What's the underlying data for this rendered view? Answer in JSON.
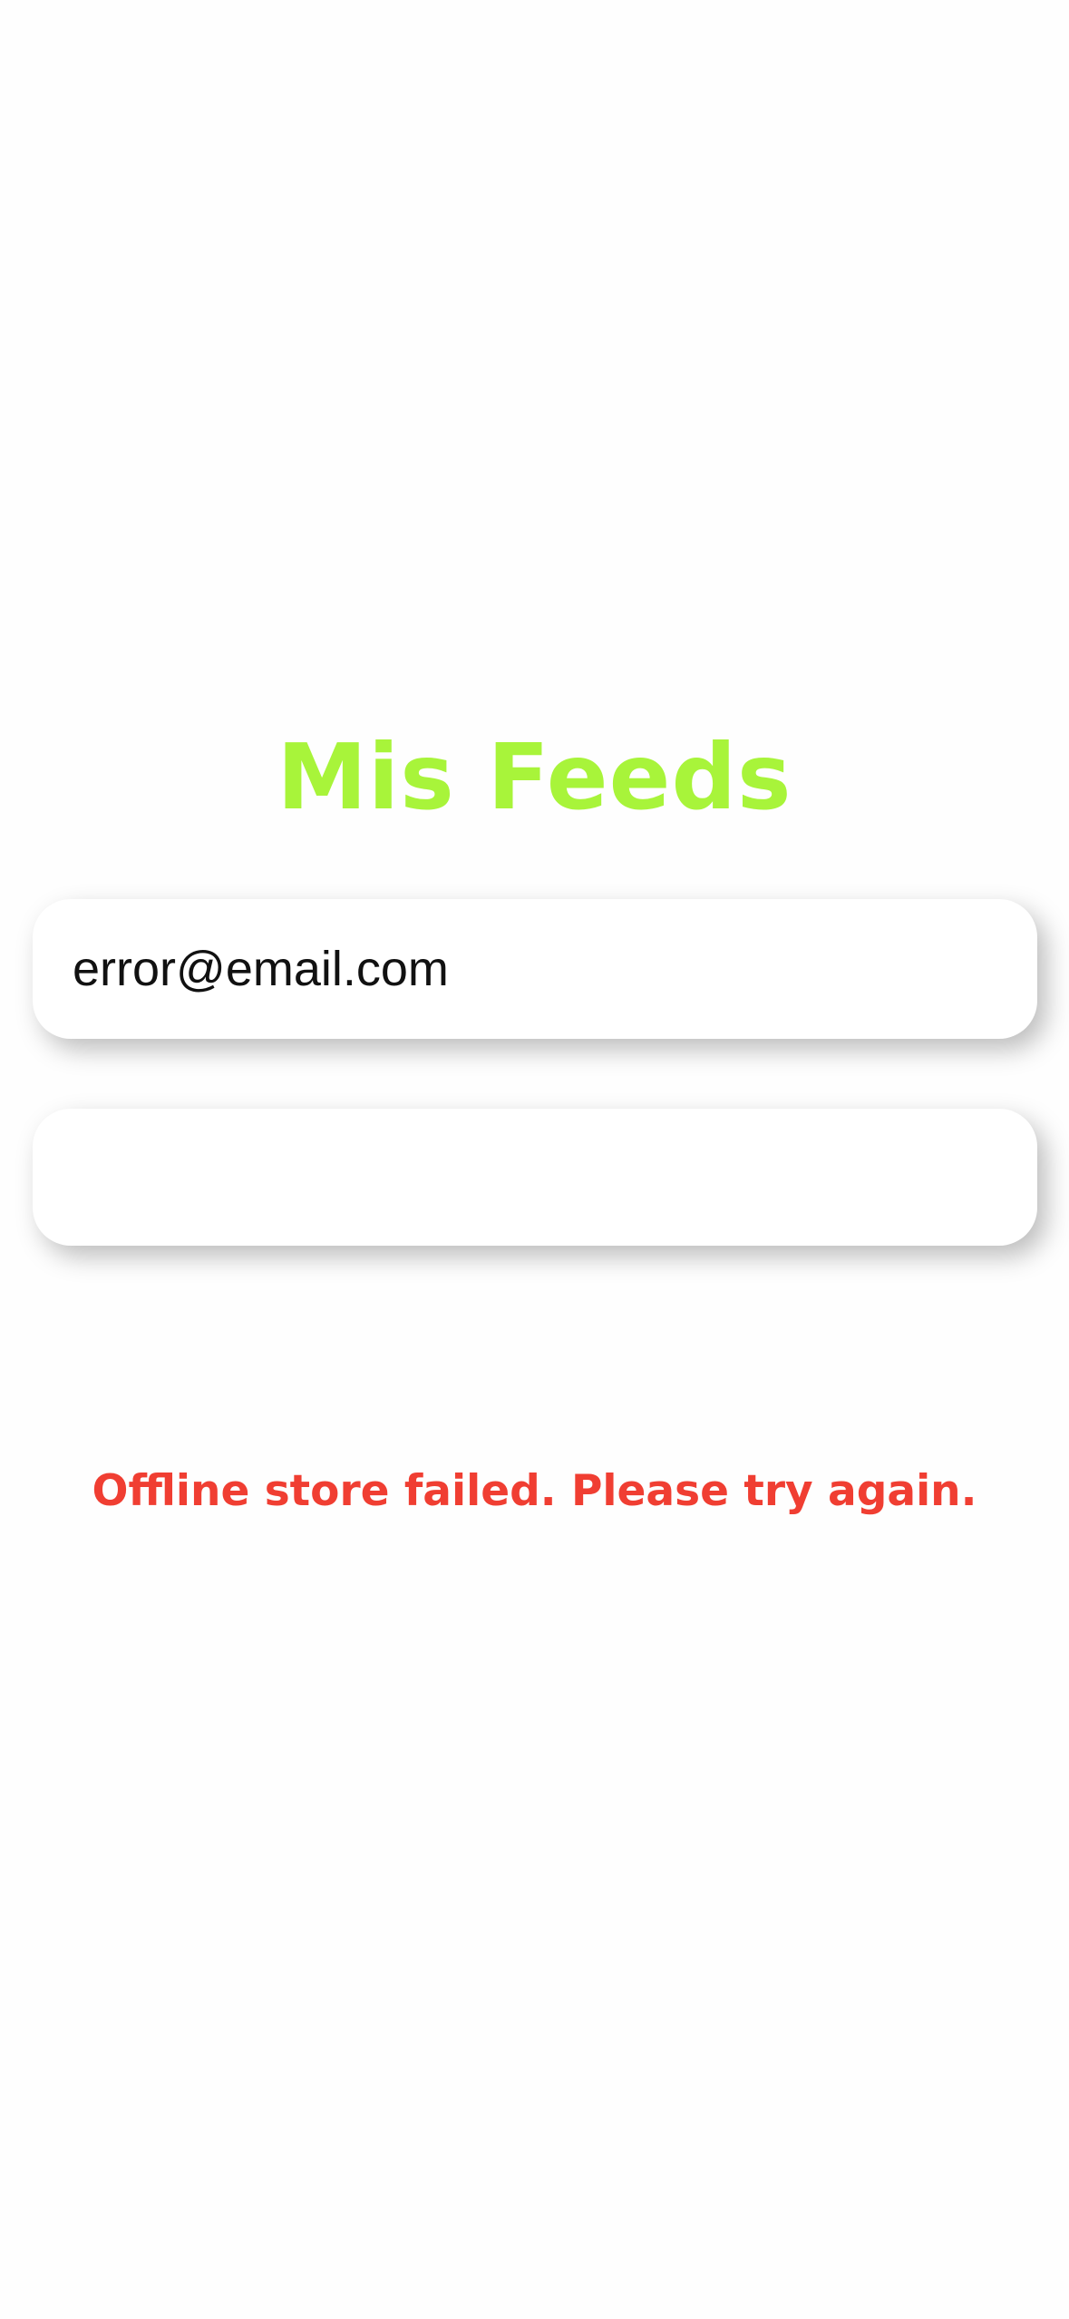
{
  "app": {
    "title": "Mis Feeds",
    "title_color": "#a8f43a"
  },
  "form": {
    "email": {
      "value": "error@email.com",
      "placeholder": ""
    },
    "password": {
      "value": "",
      "placeholder": ""
    }
  },
  "status": {
    "error_message": "Offline store failed. Please try again.",
    "error_color": "#f03e32"
  }
}
